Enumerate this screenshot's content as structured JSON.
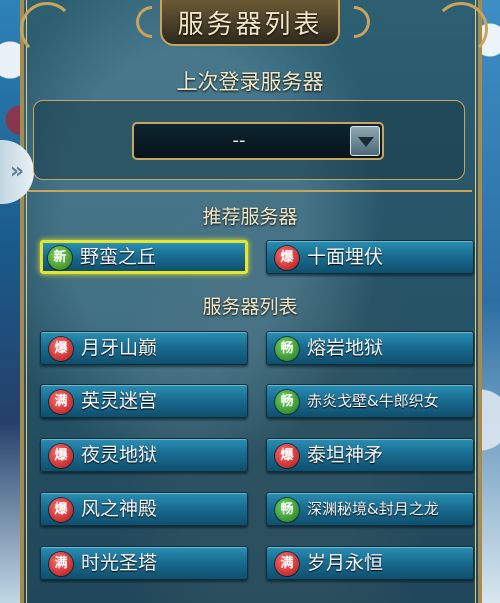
{
  "title": "服务器列表",
  "last_login": {
    "heading": "上次登录服务器",
    "value": "--"
  },
  "recommended": {
    "heading": "推荐服务器",
    "servers": [
      {
        "badge": "新",
        "status": "new",
        "name": "野蛮之丘",
        "selected": true
      },
      {
        "badge": "爆",
        "status": "full",
        "name": "十面埋伏",
        "selected": false
      }
    ]
  },
  "server_list": {
    "heading": "服务器列表",
    "servers": [
      {
        "badge": "爆",
        "status": "full",
        "name": "月牙山巅"
      },
      {
        "badge": "畅",
        "status": "smooth",
        "name": "熔岩地狱"
      },
      {
        "badge": "满",
        "status": "full",
        "name": "英灵迷宫"
      },
      {
        "badge": "畅",
        "status": "smooth",
        "name": "赤炎戈壁&牛郎织女"
      },
      {
        "badge": "爆",
        "status": "full",
        "name": "夜灵地狱"
      },
      {
        "badge": "爆",
        "status": "full",
        "name": "泰坦神矛"
      },
      {
        "badge": "爆",
        "status": "full",
        "name": "风之神殿"
      },
      {
        "badge": "畅",
        "status": "smooth",
        "name": "深渊秘境&封月之龙"
      },
      {
        "badge": "满",
        "status": "full",
        "name": "时光圣塔"
      },
      {
        "badge": "满",
        "status": "full",
        "name": "岁月永恒"
      }
    ]
  },
  "side_tab_icon": "double-chevron-right-icon",
  "colors": {
    "gold_border": "#c9a55c",
    "selected_outline": "#e6e62e",
    "button_blue": "#1a6d92",
    "badge_red": "#b01818",
    "badge_green": "#2b7d1c"
  }
}
